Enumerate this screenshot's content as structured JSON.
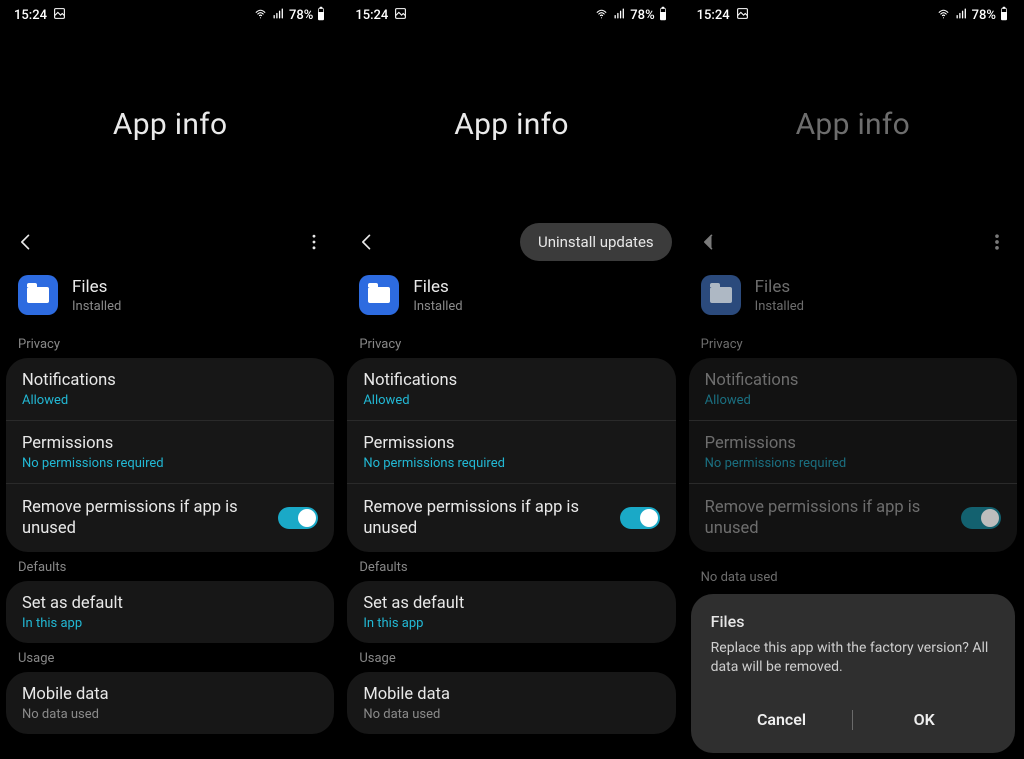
{
  "status": {
    "time": "15:24",
    "battery": "78%",
    "wifi": true,
    "signal": true
  },
  "page_title": "App info",
  "app": {
    "name": "Files",
    "status": "Installed",
    "icon": "folder-icon"
  },
  "sections": {
    "privacy": {
      "label": "Privacy",
      "notifications": {
        "title": "Notifications",
        "value": "Allowed"
      },
      "permissions": {
        "title": "Permissions",
        "value": "No permissions required"
      },
      "remove_unused": {
        "title": "Remove permissions if app is unused",
        "enabled": true
      }
    },
    "defaults": {
      "label": "Defaults",
      "set_default": {
        "title": "Set as default",
        "value": "In this app"
      }
    },
    "usage": {
      "label": "Usage",
      "mobile_data": {
        "title": "Mobile data",
        "value": "No data used"
      }
    }
  },
  "overflow": {
    "uninstall_updates": "Uninstall updates"
  },
  "dialog": {
    "title": "Files",
    "message": "Replace this app with the factory version? All data will be removed.",
    "cancel": "Cancel",
    "ok": "OK"
  }
}
